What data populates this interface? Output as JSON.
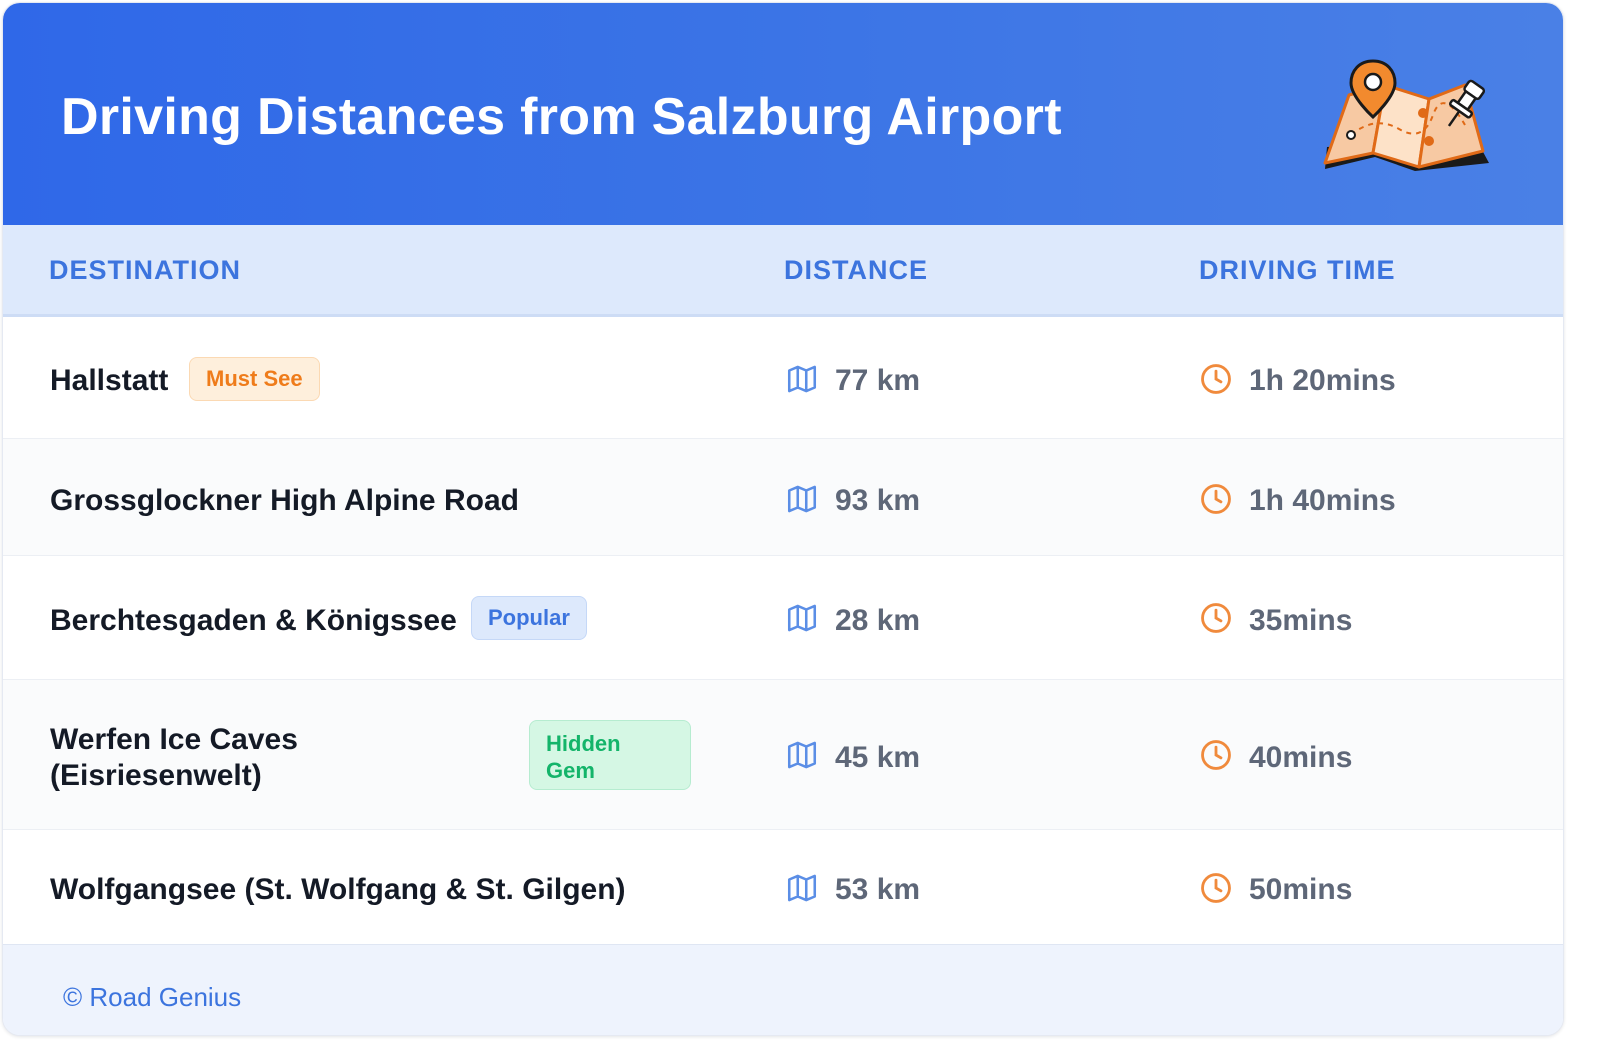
{
  "header": {
    "title": "Driving Distances from Salzburg Airport",
    "illustration": "map-with-pins-icon"
  },
  "table": {
    "columns": [
      "DESTINATION",
      "DISTANCE",
      "DRIVING TIME"
    ],
    "rows": [
      {
        "destination": "Hallstatt",
        "badge": "Must See",
        "badge_color": "orange",
        "distance": "77 km",
        "time": "1h 20mins"
      },
      {
        "destination": "Grossglockner High Alpine Road",
        "badge": "",
        "badge_color": "",
        "distance": "93 km",
        "time": "1h 40mins"
      },
      {
        "destination": "Berchtesgaden & Königssee",
        "badge": "Popular",
        "badge_color": "blue",
        "distance": "28 km",
        "time": "35mins"
      },
      {
        "destination": "Werfen Ice Caves (Eisriesenwelt)",
        "destination_lines": [
          "Werfen Ice Caves",
          "(Eisriesenwelt)"
        ],
        "badge": "Hidden Gem",
        "badge_lines": [
          "Hidden",
          "Gem"
        ],
        "badge_color": "green",
        "distance": "45 km",
        "time": "40mins"
      },
      {
        "destination": "Wolfgangsee (St. Wolfgang & St. Gilgen)",
        "badge": "",
        "badge_color": "",
        "distance": "53 km",
        "time": "50mins"
      }
    ],
    "icons": {
      "distance": "map-icon",
      "time": "clock-icon"
    }
  },
  "footer": {
    "text": "© Road Genius"
  },
  "colors": {
    "header_gradient_start": "#2f68e8",
    "header_gradient_end": "#4a80e6",
    "accent_blue": "#3c74de",
    "accent_orange": "#ef7c1b",
    "accent_green": "#14b46a",
    "icon_map": "#5b8ee6",
    "icon_clock": "#f08a3c"
  }
}
